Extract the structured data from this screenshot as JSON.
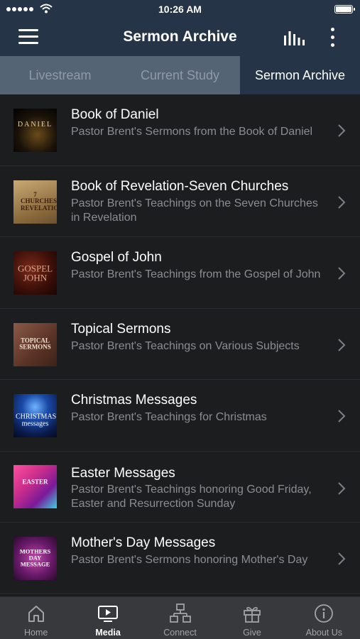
{
  "status_bar": {
    "time": "10:26 AM"
  },
  "header": {
    "title": "Sermon Archive"
  },
  "tabs": [
    {
      "label": "Livestream"
    },
    {
      "label": "Current Study"
    },
    {
      "label": "Sermon Archive"
    }
  ],
  "sermons": [
    {
      "title": "Book of Daniel",
      "subtitle": "Pastor Brent's Sermons from the Book of Daniel",
      "thumb_text": "DANIEL"
    },
    {
      "title": "Book of Revelation-Seven Churches",
      "subtitle": "Pastor Brent's Teachings on the Seven Churches in Revelation",
      "thumb_text": "7 CHURCHES REVELATION"
    },
    {
      "title": "Gospel of John",
      "subtitle": "Pastor Brent's Teachings from the Gospel of John",
      "thumb_text": "GOSPEL JOHN"
    },
    {
      "title": "Topical Sermons",
      "subtitle": "Pastor Brent's Teachings on Various Subjects",
      "thumb_text": "TOPICAL SERMONS"
    },
    {
      "title": "Christmas Messages",
      "subtitle": "Pastor Brent's Teachings for Christmas",
      "thumb_text": "CHRISTMAS messages"
    },
    {
      "title": "Easter Messages",
      "subtitle": "Pastor Brent's Teachings honoring Good Friday, Easter and Resurrection Sunday",
      "thumb_text": "EASTER"
    },
    {
      "title": "Mother's Day Messages",
      "subtitle": "Pastor Brent's Sermons honoring Mother's Day",
      "thumb_text": "MOTHERS DAY MESSAGE"
    }
  ],
  "tab_bar": {
    "home": "Home",
    "media": "Media",
    "connect": "Connect",
    "give": "Give",
    "about": "About Us"
  },
  "colors": {
    "header_bg": "#263447",
    "tab_strip_bg": "#556474",
    "list_bg": "#1c1d1f",
    "tab_bar_bg": "#38393c"
  }
}
